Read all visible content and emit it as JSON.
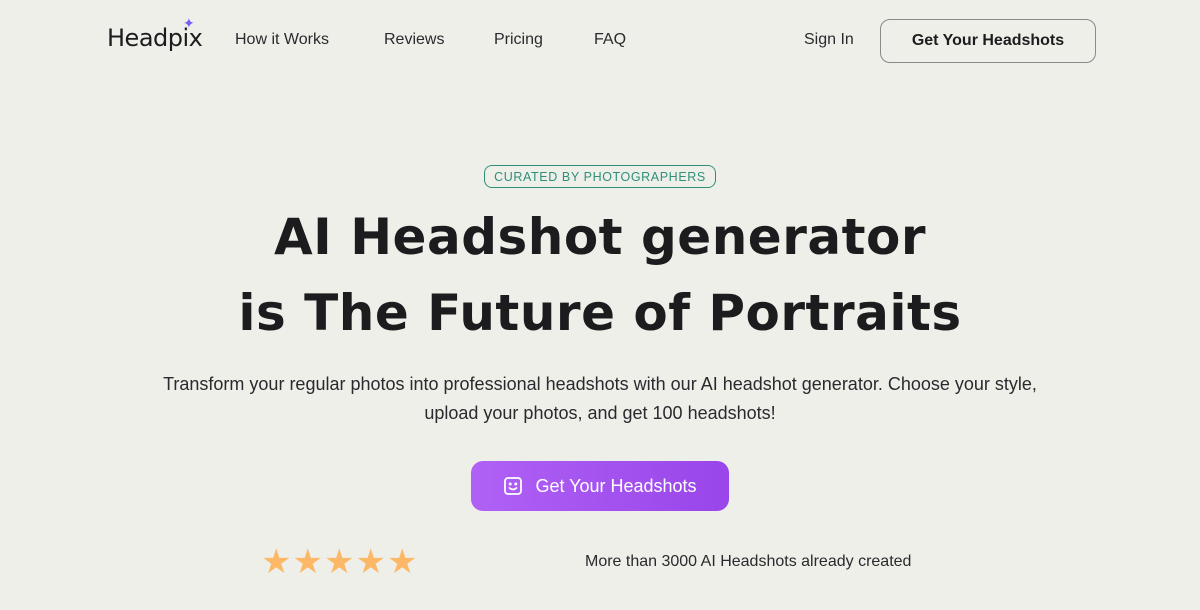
{
  "nav": {
    "logo": "Headpix",
    "logo_accent_icon": "sparkle-icon",
    "links": [
      {
        "label": "How it Works"
      },
      {
        "label": "Reviews"
      },
      {
        "label": "Pricing"
      },
      {
        "label": "FAQ"
      }
    ],
    "signin_label": "Sign In",
    "cta_label": "Get Your Headshots"
  },
  "hero": {
    "badge": "CURATED BY PHOTOGRAPHERS",
    "title_line1": "AI Headshot generator",
    "title_line2": "is The Future of Portraits",
    "subtitle_line1": "Transform your regular photos into professional headshots with our AI headshot generator. Choose your style,",
    "subtitle_line2": "upload your photos, and get 100 headshots!",
    "cta_label": "Get Your Headshots",
    "cta_icon": "smiley-face-icon",
    "rating": 5,
    "rating_max": 5,
    "social_proof": "More than 3000 AI Headshots already created"
  },
  "colors": {
    "background": "#efefea",
    "accent_purple": "#a452f0",
    "badge_teal": "#2f8f7b",
    "star": "#fcb866",
    "logo_star": "#7a5af5"
  }
}
